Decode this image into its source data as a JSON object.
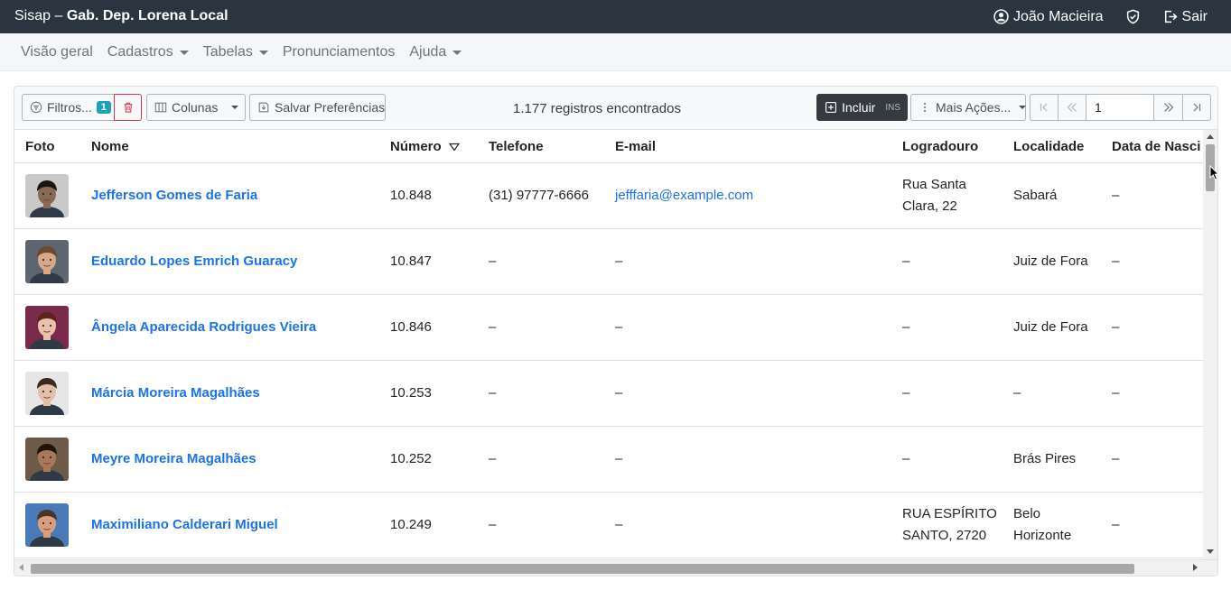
{
  "header": {
    "app_name": "Sisap –",
    "office": "Gab. Dep. Lorena Local",
    "user": "João Macieira",
    "logout": "Sair"
  },
  "menu": [
    {
      "label": "Visão geral",
      "dropdown": false
    },
    {
      "label": "Cadastros",
      "dropdown": true
    },
    {
      "label": "Tabelas",
      "dropdown": true
    },
    {
      "label": "Pronunciamentos",
      "dropdown": false
    },
    {
      "label": "Ajuda",
      "dropdown": true
    }
  ],
  "toolbar": {
    "filters_label": "Filtros...",
    "filters_count": "1",
    "columns_label": "Colunas",
    "save_prefs_label": "Salvar Preferências",
    "records_text": "1.177 registros encontrados",
    "include_label": "Incluir",
    "include_shortcut": "INS",
    "more_actions_label": "Mais Ações...",
    "page_value": "1"
  },
  "table": {
    "headers": {
      "foto": "Foto",
      "nome": "Nome",
      "numero": "Número",
      "telefone": "Telefone",
      "email": "E-mail",
      "logradouro": "Logradouro",
      "localidade": "Localidade",
      "nascimento": "Data de Nasci"
    },
    "rows": [
      {
        "nome": "Jefferson Gomes de Faria",
        "numero": "10.848",
        "telefone": "(31) 97777-6666",
        "email": "jefffaria@example.com",
        "logradouro": "Rua Santa Clara, 22",
        "localidade": "Sabará",
        "nascimento": "–",
        "skin": "#8a6a55",
        "hair": "#1b1410",
        "bg": "#c9c9c9"
      },
      {
        "nome": "Eduardo Lopes Emrich Guaracy",
        "numero": "10.847",
        "telefone": "–",
        "email": "–",
        "logradouro": "–",
        "localidade": "Juiz de Fora",
        "nascimento": "–",
        "skin": "#d8a88a",
        "hair": "#6b4a2e",
        "bg": "#5d6670"
      },
      {
        "nome": "Ângela Aparecida Rodrigues Vieira",
        "numero": "10.846",
        "telefone": "–",
        "email": "–",
        "logradouro": "–",
        "localidade": "Juiz de Fora",
        "nascimento": "–",
        "skin": "#eac2ab",
        "hair": "#5a2418",
        "bg": "#7a2a4a"
      },
      {
        "nome": "Márcia Moreira Magalhães",
        "numero": "10.253",
        "telefone": "–",
        "email": "–",
        "logradouro": "–",
        "localidade": "–",
        "nascimento": "–",
        "skin": "#e3bfa8",
        "hair": "#3a2a20",
        "bg": "#e6e6e6"
      },
      {
        "nome": "Meyre Moreira Magalhães",
        "numero": "10.252",
        "telefone": "–",
        "email": "–",
        "logradouro": "–",
        "localidade": "Brás Pires",
        "nascimento": "–",
        "skin": "#a9775a",
        "hair": "#1e140e",
        "bg": "#6d5a48"
      },
      {
        "nome": "Maximiliano Calderari Miguel",
        "numero": "10.249",
        "telefone": "–",
        "email": "–",
        "logradouro": "RUA ESPÍRITO SANTO, 2720",
        "localidade": "Belo Horizonte",
        "nascimento": "–",
        "skin": "#d99d7f",
        "hair": "#4a3526",
        "bg": "#4a7ab8"
      }
    ]
  }
}
